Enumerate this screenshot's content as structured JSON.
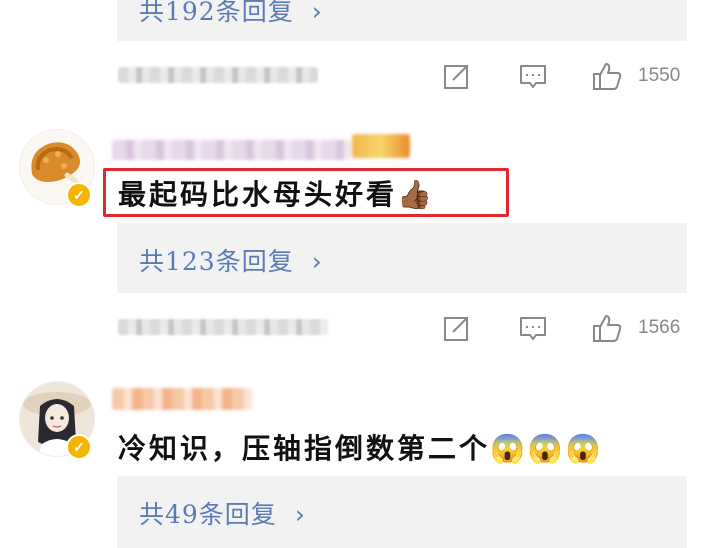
{
  "comments": [
    {
      "reply_link": "共192条回复",
      "chevron": "›",
      "like_count": "1550"
    },
    {
      "text": "最起码比水母头好看",
      "emoji": "👍🏾",
      "reply_link": "共123条回复",
      "chevron": "›",
      "like_count": "1566"
    },
    {
      "text": "冷知识，压轴指倒数第二个",
      "emoji": "😱😱😱",
      "reply_link": "共49条回复",
      "chevron": "›"
    }
  ],
  "colors": {
    "reply_link": "#5a7bb7",
    "highlight": "#e0282e",
    "verified_badge": "#f5b400"
  },
  "icons": [
    "share-icon",
    "comment-icon",
    "thumbs-up-icon",
    "verified-badge-icon",
    "chevron-right-icon"
  ]
}
